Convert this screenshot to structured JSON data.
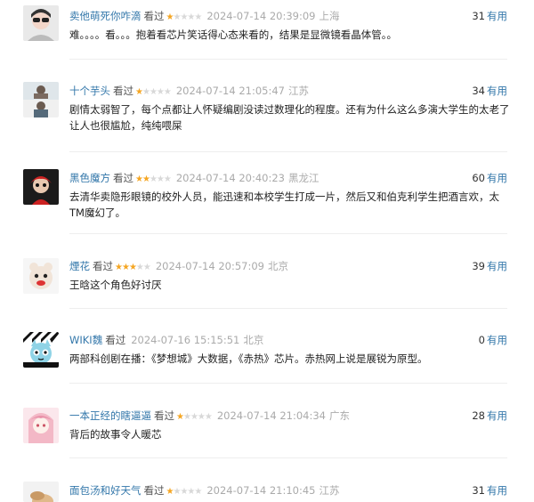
{
  "reviews": [
    {
      "user": "卖他萌死你咋滴",
      "status": "看过",
      "rating": 1,
      "time": "2024-07-14 20:39:09",
      "location": "上海",
      "votes": "31",
      "useful_label": "有用",
      "content": "难。。。。看。。。抱着看芯片笑话得心态来看的，结果是显微镜看晶体管。。"
    },
    {
      "user": "十个芋头",
      "status": "看过",
      "rating": 1,
      "time": "2024-07-14 21:05:47",
      "location": "江苏",
      "votes": "34",
      "useful_label": "有用",
      "content": "剧情太弱智了，每个点都让人怀疑编剧没读过数理化的程度。还有为什么这么多演大学生的太老了让人也很尴尬，纯纯喂屎"
    },
    {
      "user": "黑色魔方",
      "status": "看过",
      "rating": 2,
      "time": "2024-07-14 20:40:23",
      "location": "黑龙江",
      "votes": "60",
      "useful_label": "有用",
      "content": "去清华卖隐形眼镜的校外人员，能迅速和本校学生打成一片，然后又和伯克利学生把酒言欢，太TM魔幻了。"
    },
    {
      "user": "煙花",
      "status": "看过",
      "rating": 3,
      "time": "2024-07-14 20:57:09",
      "location": "北京",
      "votes": "39",
      "useful_label": "有用",
      "content": "王晗这个角色好讨厌"
    },
    {
      "user": "WIKI魏",
      "status": "看过",
      "rating": 0,
      "time": "2024-07-16 15:15:51",
      "location": "北京",
      "votes": "0",
      "useful_label": "有用",
      "content": "两部科创剧在播：《梦想城》大数据，《赤热》芯片。赤热网上说是展锐为原型。"
    },
    {
      "user": "一本正经的瞎逼逼",
      "status": "看过",
      "rating": 1,
      "time": "2024-07-14 21:04:34",
      "location": "广东",
      "votes": "28",
      "useful_label": "有用",
      "content": "背后的故事令人暖芯"
    },
    {
      "user": "面包汤和好天气",
      "status": "看过",
      "rating": 1,
      "time": "2024-07-14 21:10:45",
      "location": "江苏",
      "votes": "31",
      "useful_label": "有用",
      "content": ""
    }
  ],
  "colors": {
    "link": "#3377aa",
    "star_on": "#f5a623",
    "star_off": "#d8d8d8",
    "meta": "#aaaaaa"
  },
  "icons": [
    "avatar",
    "star-icon"
  ]
}
